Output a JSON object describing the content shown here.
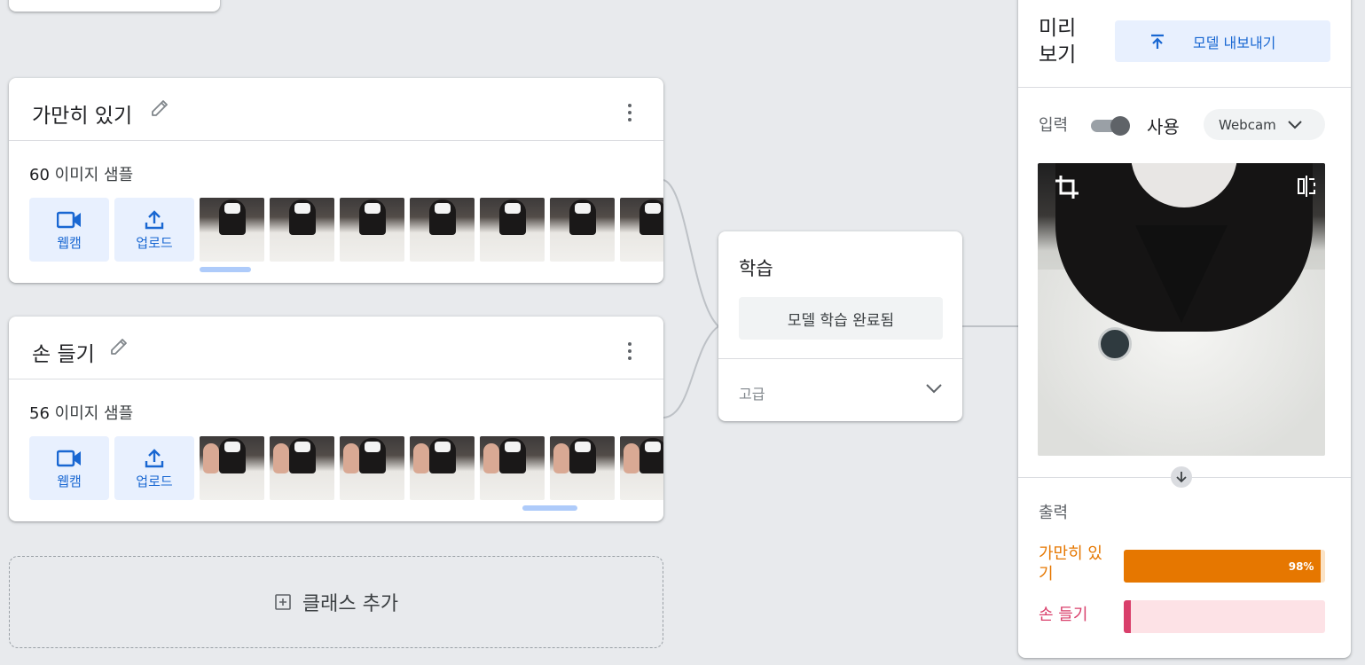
{
  "classes": [
    {
      "title": "가만히 있기",
      "sample_count": "60",
      "sample_label": "이미지 샘플",
      "webcam_label": "웹캠",
      "upload_label": "업로드",
      "thumbnail_count": 7,
      "thumbnail_kind": "still"
    },
    {
      "title": "손 들기",
      "sample_count": "56",
      "sample_label": "이미지 샘플",
      "webcam_label": "웹캠",
      "upload_label": "업로드",
      "thumbnail_count": 7,
      "thumbnail_kind": "hand-raised"
    }
  ],
  "add_class_label": "클래스 추가",
  "training": {
    "title": "학습",
    "status_button": "모델 학습 완료됨",
    "advanced_label": "고급"
  },
  "preview": {
    "title": "미리 보기",
    "export_button": "모델 내보내기",
    "input_label": "입력",
    "toggle_label": "사용",
    "toggle_on": true,
    "source_select": "Webcam",
    "output_label": "출력",
    "outputs": [
      {
        "label": "가만히 있기",
        "percent_text": "98%",
        "fraction": 0.98,
        "color": "#e67700",
        "track": "#fbe3c6"
      },
      {
        "label": "손 들기",
        "percent_text": "",
        "fraction": 0.02,
        "color": "#d93f6b",
        "track": "#fde2e6"
      }
    ]
  },
  "colors": {
    "accent_blue": "#1967d2",
    "accent_blue_bg": "#e8f0fe",
    "page_bg": "#e8eaed"
  }
}
